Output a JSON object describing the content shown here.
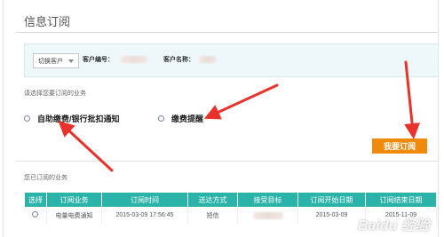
{
  "page": {
    "title": "信息订阅"
  },
  "customer_bar": {
    "switch_label": "切换客户",
    "customer_no_label": "客户编号：",
    "customer_name_label": "客户名称："
  },
  "prompt": "请选择您要订阅的业务",
  "options": [
    {
      "label": "自助缴费/银行批扣通知"
    },
    {
      "label": "缴费提醒"
    }
  ],
  "subscribe_button": "我要订阅",
  "subscribed_heading": "您已订阅的业务",
  "table": {
    "headers": [
      "选择",
      "订阅业务",
      "订阅时间",
      "送达方式",
      "接受目标",
      "订阅开始日期",
      "订阅结束日期"
    ],
    "rows": [
      {
        "business": "电量电费通知",
        "time": "2015-03-09 17:56:45",
        "method": "短信",
        "start": "2015-03-09",
        "end": "2015-11-09"
      }
    ]
  },
  "watermark": "Baidu 经验",
  "colors": {
    "accent_orange": "#f08a0d",
    "table_header": "#2ab3a9",
    "arrow_red": "#e8322b",
    "bar_bg": "#eef8fb"
  }
}
